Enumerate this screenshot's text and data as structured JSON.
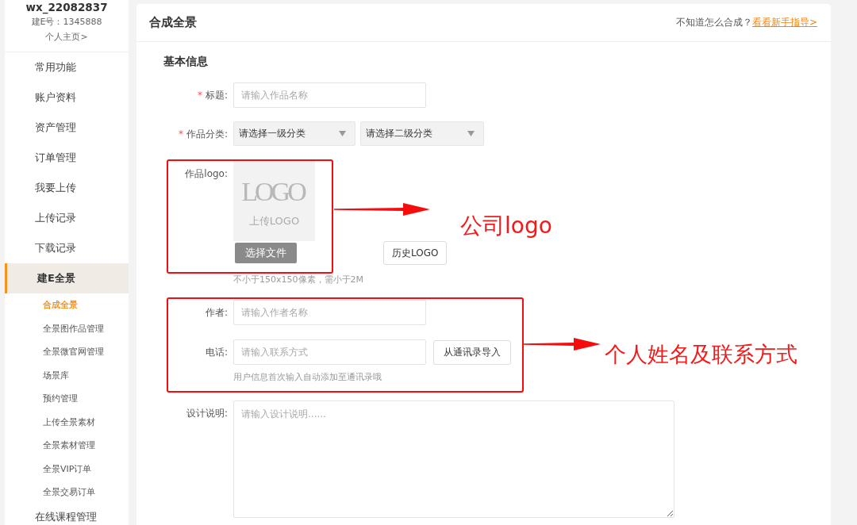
{
  "sidebar": {
    "user": {
      "name": "wx_22082837",
      "account": "建E号：1345888",
      "profile_link": "个人主页>"
    },
    "items": [
      {
        "label": "常用功能",
        "selected": false
      },
      {
        "label": "账户资料",
        "selected": false
      },
      {
        "label": "资产管理",
        "selected": false
      },
      {
        "label": "订单管理",
        "selected": false
      },
      {
        "label": "我要上传",
        "selected": false
      },
      {
        "label": "上传记录",
        "selected": false
      },
      {
        "label": "下载记录",
        "selected": false
      },
      {
        "label": "建E全景",
        "selected": true,
        "children": [
          {
            "label": "合成全景",
            "selected": true
          },
          {
            "label": "全景图作品管理",
            "selected": false
          },
          {
            "label": "全景微官网管理",
            "selected": false
          },
          {
            "label": "场景库",
            "selected": false
          },
          {
            "label": "预约管理",
            "selected": false
          },
          {
            "label": "上传全景素材",
            "selected": false
          },
          {
            "label": "全景素材管理",
            "selected": false
          },
          {
            "label": "全景VIP订单",
            "selected": false
          },
          {
            "label": "全景交易订单",
            "selected": false
          }
        ]
      },
      {
        "label": "在线课程管理",
        "selected": false
      }
    ]
  },
  "panel": {
    "title": "合成全景",
    "help_text": "不知道怎么合成？",
    "help_link": "看看新手指导>"
  },
  "form": {
    "section_title": "基本信息",
    "fields": [
      {
        "kind": "text",
        "required_mark": "*",
        "label": "标题:",
        "placeholder": "请输入作品名称"
      },
      {
        "kind": "select",
        "required_mark": "*",
        "label": "作品分类:",
        "dropdowns": [
          "请选择一级分类",
          "请选择二级分类"
        ]
      },
      {
        "kind": "logo",
        "label": "作品logo:",
        "preview": {
          "mark": "LOGO",
          "caption": "上传LOGO"
        },
        "buttons": [
          {
            "kind": "primary",
            "label": "选择文件"
          },
          {
            "kind": "secondary",
            "label": "历史LOGO"
          }
        ],
        "hint": "不小于150x150像素，需小于2M"
      },
      {
        "kind": "text",
        "label": "作者:",
        "placeholder": "请输入作者名称"
      },
      {
        "kind": "text",
        "label": "电话:",
        "placeholder": "请输入联系方式",
        "button": {
          "kind": "secondary",
          "label": "从通讯录导入"
        },
        "hint": "用户信息首次输入自动添加至通讯录哦"
      },
      {
        "kind": "textarea",
        "label": "设计说明:",
        "placeholder": "请输入设计说明......"
      }
    ]
  },
  "annotations": [
    {
      "text": "公司logo"
    },
    {
      "text": "个人姓名及联系方式"
    }
  ]
}
